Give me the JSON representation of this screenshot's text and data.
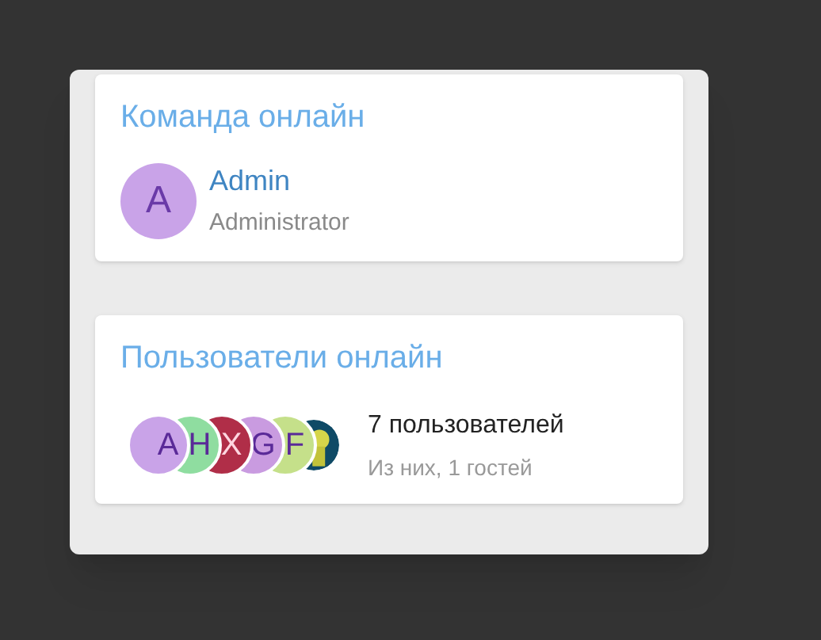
{
  "team_online": {
    "title": "Команда онлайн",
    "members": [
      {
        "initial": "A",
        "color": "#c9a3e8",
        "name": "Admin",
        "role": "Administrator"
      }
    ]
  },
  "users_online": {
    "title": "Пользователи онлайн",
    "avatars": [
      {
        "kind": "letter",
        "initial": "A",
        "color": "#c9a3e8"
      },
      {
        "kind": "letter",
        "initial": "H",
        "color": "#8fdda0"
      },
      {
        "kind": "letter",
        "initial": "X",
        "color": "#b02e48"
      },
      {
        "kind": "letter",
        "initial": "G",
        "color": "#c99be0"
      },
      {
        "kind": "letter",
        "initial": "F",
        "color": "#c5e08a"
      },
      {
        "kind": "picture"
      }
    ],
    "count": "7 пользователей",
    "guests": "Из них, 1 гостей"
  }
}
